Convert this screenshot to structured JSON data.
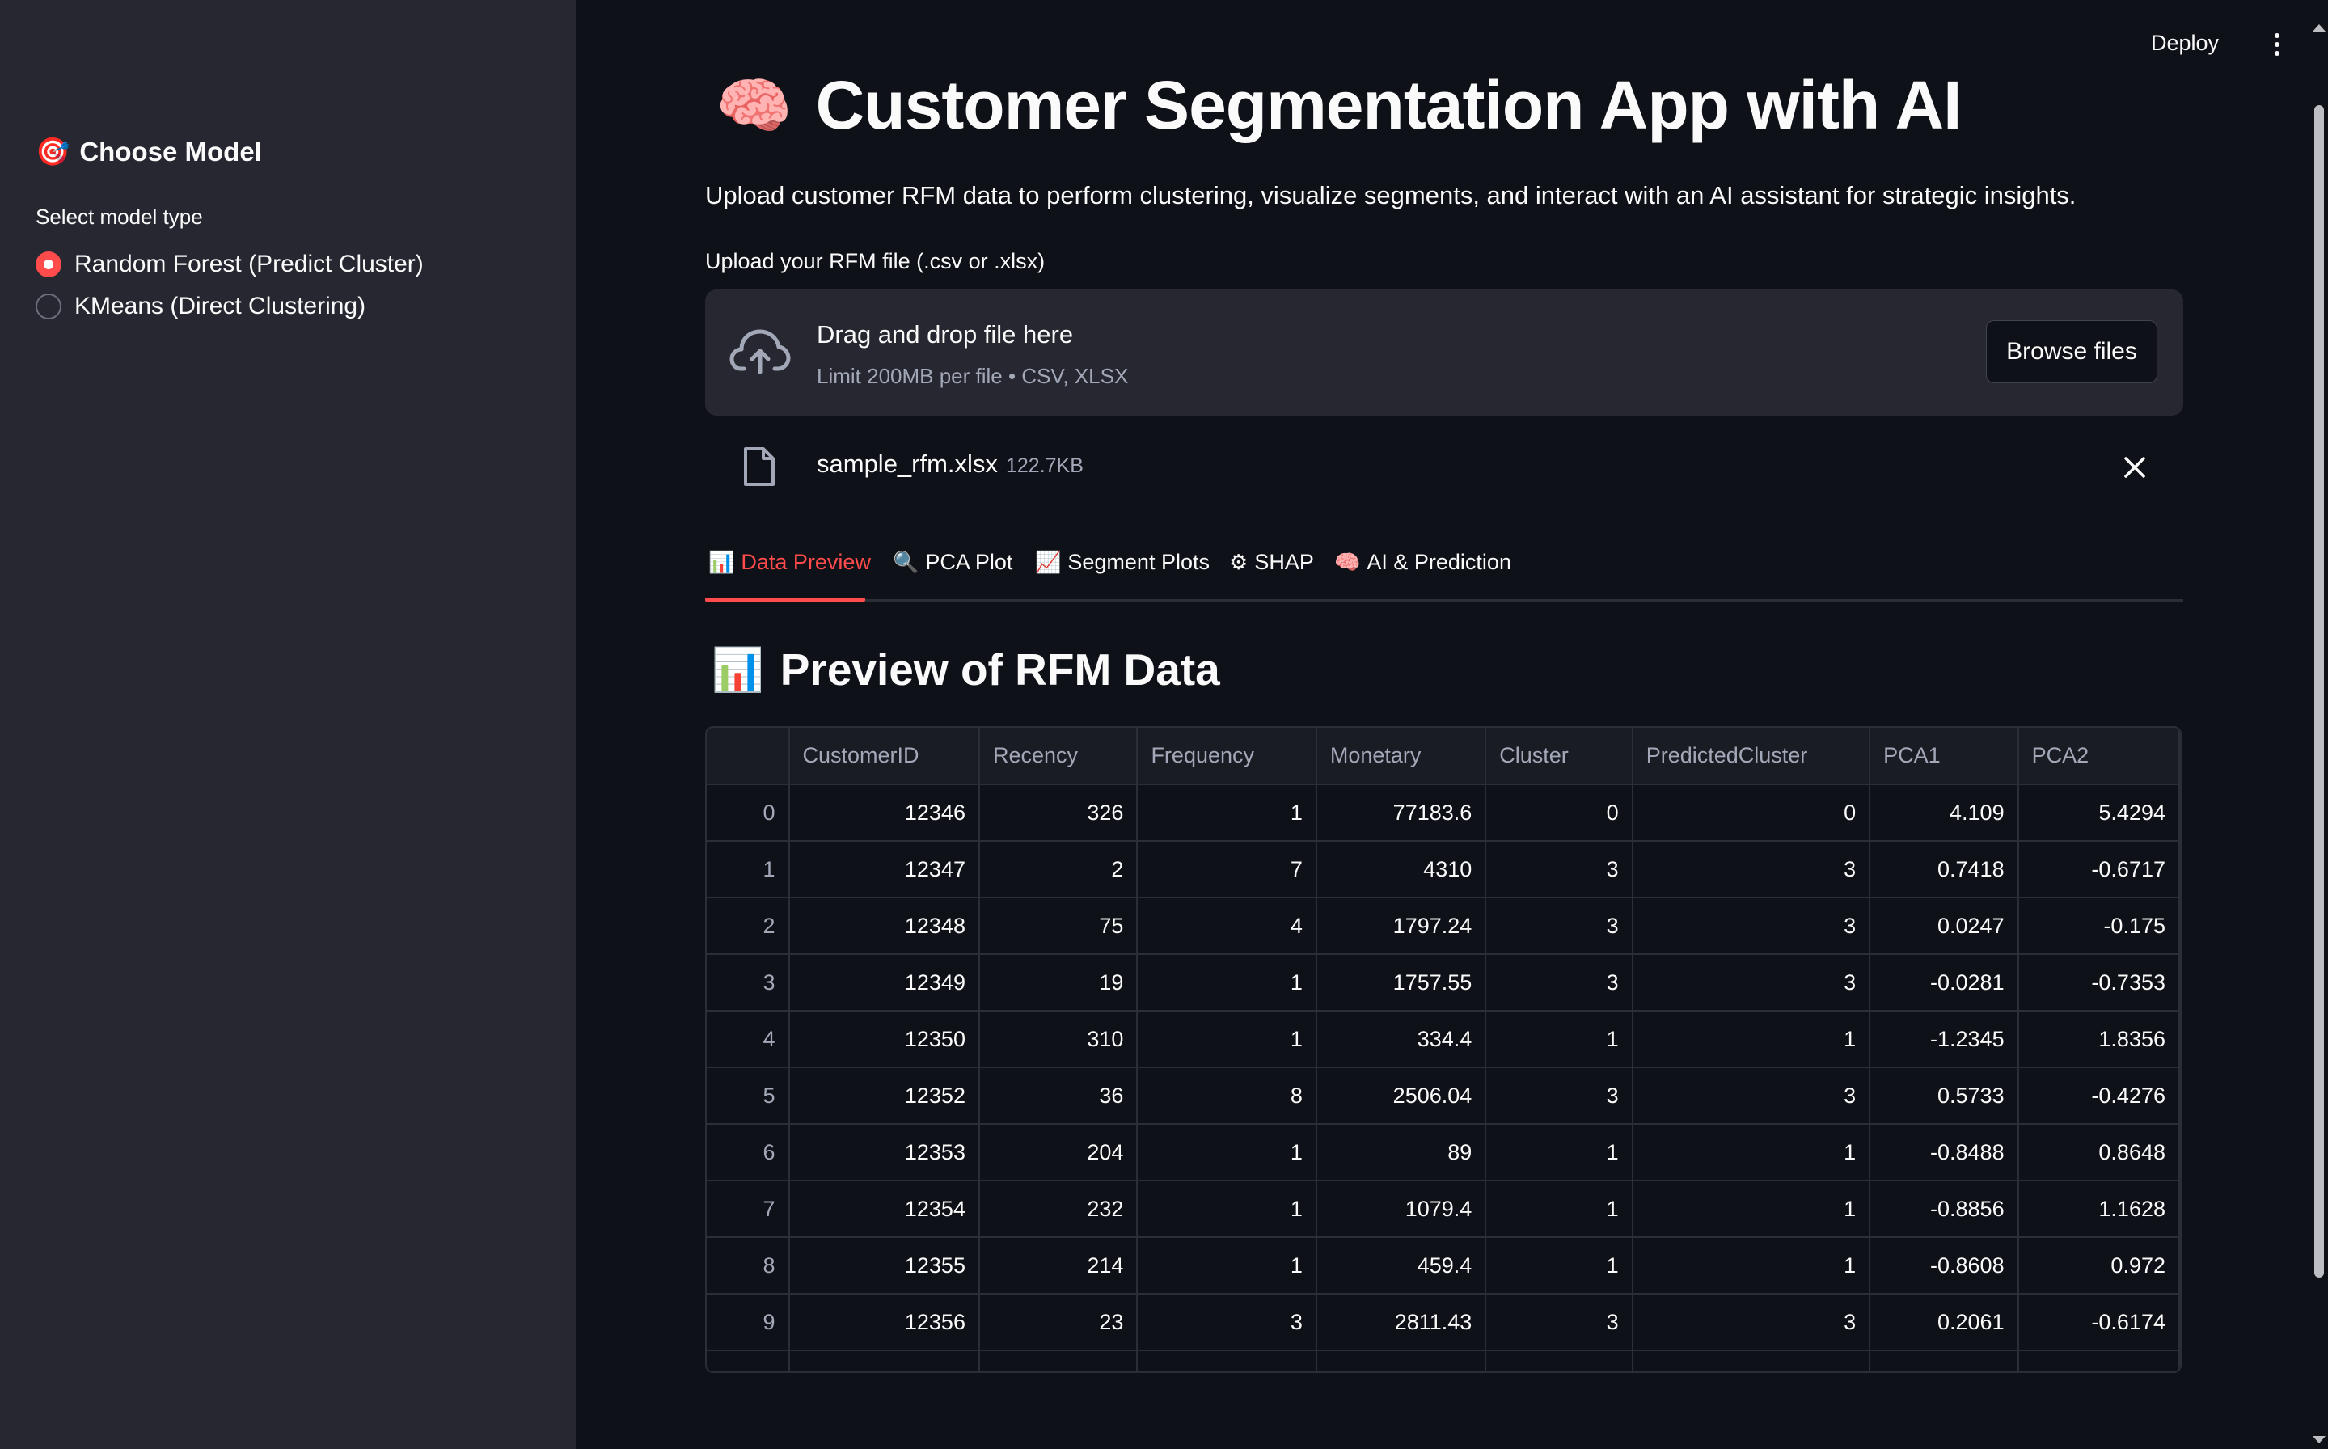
{
  "sidebar": {
    "header": "Choose Model",
    "header_emoji": "🎯",
    "select_label": "Select model type",
    "options": [
      {
        "label": "Random Forest (Predict Cluster)",
        "selected": true
      },
      {
        "label": "KMeans (Direct Clustering)",
        "selected": false
      }
    ]
  },
  "toolbar": {
    "deploy_label": "Deploy",
    "menu_icon": "kebab-menu-icon"
  },
  "main": {
    "title": "Customer Segmentation App with AI",
    "title_emoji": "🧠",
    "subtitle": "Upload customer RFM data to perform clustering, visualize segments, and interact with an AI assistant for strategic insights.",
    "upload": {
      "label": "Upload your RFM file (.csv or .xlsx)",
      "drop_title": "Drag and drop file here",
      "drop_limit": "Limit 200MB per file • CSV, XLSX",
      "browse_label": "Browse files",
      "file_name": "sample_rfm.xlsx",
      "file_size": "122.7KB"
    },
    "tabs": [
      {
        "emoji": "📊",
        "label": "Data Preview",
        "active": true
      },
      {
        "emoji": "🔍",
        "label": "PCA Plot",
        "active": false
      },
      {
        "emoji": "📈",
        "label": "Segment Plots",
        "active": false
      },
      {
        "emoji": "⚙",
        "label": "SHAP",
        "active": false
      },
      {
        "emoji": "🧠",
        "label": "AI & Prediction",
        "active": false
      }
    ],
    "section_emoji": "📊",
    "section_title": "Preview of RFM Data",
    "table": {
      "columns": [
        "",
        "CustomerID",
        "Recency",
        "Frequency",
        "Monetary",
        "Cluster",
        "PredictedCluster",
        "PCA1",
        "PCA2"
      ],
      "rows": [
        [
          "0",
          "12346",
          "326",
          "1",
          "77183.6",
          "0",
          "0",
          "4.109",
          "5.4294"
        ],
        [
          "1",
          "12347",
          "2",
          "7",
          "4310",
          "3",
          "3",
          "0.7418",
          "-0.6717"
        ],
        [
          "2",
          "12348",
          "75",
          "4",
          "1797.24",
          "3",
          "3",
          "0.0247",
          "-0.175"
        ],
        [
          "3",
          "12349",
          "19",
          "1",
          "1757.55",
          "3",
          "3",
          "-0.0281",
          "-0.7353"
        ],
        [
          "4",
          "12350",
          "310",
          "1",
          "334.4",
          "1",
          "1",
          "-1.2345",
          "1.8356"
        ],
        [
          "5",
          "12352",
          "36",
          "8",
          "2506.04",
          "3",
          "3",
          "0.5733",
          "-0.4276"
        ],
        [
          "6",
          "12353",
          "204",
          "1",
          "89",
          "1",
          "1",
          "-0.8488",
          "0.8648"
        ],
        [
          "7",
          "12354",
          "232",
          "1",
          "1079.4",
          "1",
          "1",
          "-0.8856",
          "1.1628"
        ],
        [
          "8",
          "12355",
          "214",
          "1",
          "459.4",
          "1",
          "1",
          "-0.8608",
          "0.972"
        ],
        [
          "9",
          "12356",
          "23",
          "3",
          "2811.43",
          "3",
          "3",
          "0.2061",
          "-0.6174"
        ]
      ]
    }
  },
  "colors": {
    "accent": "#ff4b4b",
    "background": "#0e1117",
    "sidebar": "#262730"
  }
}
